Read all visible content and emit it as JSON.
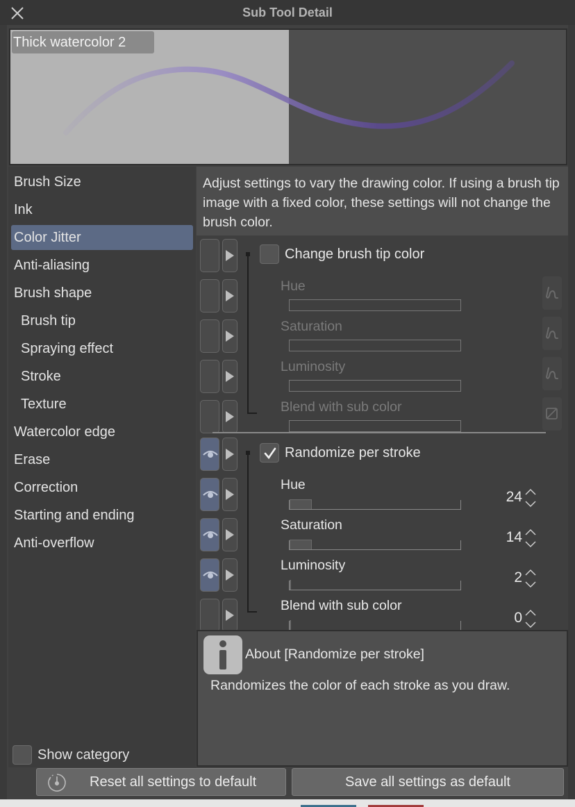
{
  "window": {
    "title": "Sub Tool Detail",
    "close_icon": "close-x-icon"
  },
  "preview": {
    "brush_name": "Thick watercolor 2",
    "stroke_color": "#7a5fb0"
  },
  "sidebar": {
    "items": [
      {
        "label": "Brush Size",
        "sub": false,
        "selected": false
      },
      {
        "label": "Ink",
        "sub": false,
        "selected": false
      },
      {
        "label": "Color Jitter",
        "sub": false,
        "selected": true
      },
      {
        "label": "Anti-aliasing",
        "sub": false,
        "selected": false
      },
      {
        "label": "Brush shape",
        "sub": false,
        "selected": false
      },
      {
        "label": "Brush tip",
        "sub": true,
        "selected": false
      },
      {
        "label": "Spraying effect",
        "sub": true,
        "selected": false
      },
      {
        "label": "Stroke",
        "sub": true,
        "selected": false
      },
      {
        "label": "Texture",
        "sub": true,
        "selected": false
      },
      {
        "label": "Watercolor edge",
        "sub": false,
        "selected": false
      },
      {
        "label": "Erase",
        "sub": false,
        "selected": false
      },
      {
        "label": "Correction",
        "sub": false,
        "selected": false
      },
      {
        "label": "Starting and ending",
        "sub": false,
        "selected": false
      },
      {
        "label": "Anti-overflow",
        "sub": false,
        "selected": false
      }
    ],
    "show_category": {
      "label": "Show category",
      "checked": false
    }
  },
  "description": "Adjust settings to vary the drawing color. If using a brush tip image with a fixed color, these settings will not change the brush color.",
  "groups": [
    {
      "label": "Change brush tip color",
      "checked": false,
      "eye_on": false,
      "params": [
        {
          "label": "Hue",
          "enabled": false,
          "eye_on": false,
          "pressure_icon": "pen-pressure-icon"
        },
        {
          "label": "Saturation",
          "enabled": false,
          "eye_on": false,
          "pressure_icon": "pen-pressure-icon"
        },
        {
          "label": "Luminosity",
          "enabled": false,
          "eye_on": false,
          "pressure_icon": "pen-pressure-icon"
        },
        {
          "label": "Blend with sub color",
          "enabled": false,
          "eye_on": false,
          "pressure_icon": "slash-box-icon"
        }
      ]
    },
    {
      "label": "Randomize per stroke",
      "checked": true,
      "eye_on": true,
      "params": [
        {
          "label": "Hue",
          "enabled": true,
          "eye_on": true,
          "value": "24",
          "fraction": 0.13
        },
        {
          "label": "Saturation",
          "enabled": true,
          "eye_on": true,
          "value": "14",
          "fraction": 0.13
        },
        {
          "label": "Luminosity",
          "enabled": true,
          "eye_on": true,
          "value": "2",
          "fraction": 0.01
        },
        {
          "label": "Blend with sub color",
          "enabled": true,
          "eye_on": false,
          "value": "0",
          "fraction": 0
        }
      ]
    }
  ],
  "about": {
    "title": "About [Randomize per stroke]",
    "text": "Randomizes the color of each stroke as you draw."
  },
  "buttons": {
    "reset": "Reset all settings to default",
    "save": "Save all settings as default"
  },
  "colors": {
    "selected_bg": "#5c6a85",
    "eye_on_bg": "#5b6680"
  }
}
